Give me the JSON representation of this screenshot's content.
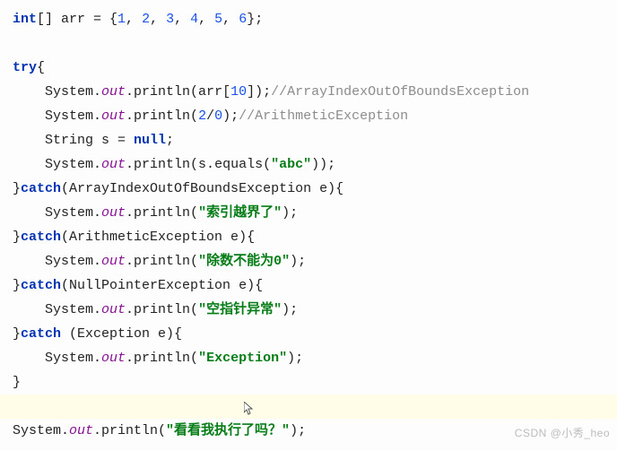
{
  "code": {
    "l1_kw": "int",
    "l1_arr": "[] arr = {",
    "l1_n1": "1",
    "l1_c": ", ",
    "l1_n2": "2",
    "l1_n3": "3",
    "l1_n4": "4",
    "l1_n5": "5",
    "l1_n6": "6",
    "l1_end": "};",
    "l2_try": "try",
    "l2_brace": "{",
    "l3_a": "    System.",
    "l3_out": "out",
    "l3_b": ".println(arr[",
    "l3_n": "10",
    "l3_c": "]);",
    "l3_cm": "//ArrayIndexOutOfBoundsException",
    "l4_a": "    System.",
    "l4_out": "out",
    "l4_b": ".println(",
    "l4_n1": "2",
    "l4_s": "/",
    "l4_n2": "0",
    "l4_c": ");",
    "l4_cm": "//ArithmeticException",
    "l5_a": "    String s = ",
    "l5_null": "null",
    "l5_b": ";",
    "l6_a": "    System.",
    "l6_out": "out",
    "l6_b": ".println(s.equals(",
    "l6_s": "\"abc\"",
    "l6_c": "));",
    "l7_a": "}",
    "l7_kw": "catch",
    "l7_b": "(ArrayIndexOutOfBoundsException e){",
    "l8_a": "    System.",
    "l8_out": "out",
    "l8_b": ".println(",
    "l8_s": "\"索引越界了\"",
    "l8_c": ");",
    "l9_a": "}",
    "l9_kw": "catch",
    "l9_b": "(ArithmeticException e){",
    "l10_a": "    System.",
    "l10_out": "out",
    "l10_b": ".println(",
    "l10_s": "\"除数不能为0\"",
    "l10_c": ");",
    "l11_a": "}",
    "l11_kw": "catch",
    "l11_b": "(NullPointerException e){",
    "l12_a": "    System.",
    "l12_out": "out",
    "l12_b": ".println(",
    "l12_s": "\"空指针异常\"",
    "l12_c": ");",
    "l13_a": "}",
    "l13_kw": "catch",
    "l13_b": " (Exception e){",
    "l14_a": "    System.",
    "l14_out": "out",
    "l14_b": ".println(",
    "l14_s": "\"Exception\"",
    "l14_c": ");",
    "l15": "}",
    "l16_a": "System.",
    "l16_out": "out",
    "l16_b": ".println(",
    "l16_s": "\"看看我执行了吗？\"",
    "l16_c": ");"
  },
  "watermark": "CSDN @小秀_heo"
}
